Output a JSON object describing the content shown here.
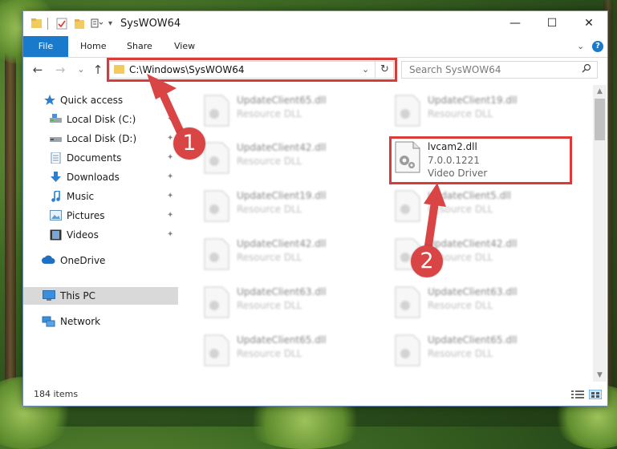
{
  "window": {
    "title": "SysWOW64",
    "controls": {
      "minimize": "—",
      "maximize": "☐",
      "close": "✕"
    }
  },
  "ribbon": {
    "tabs": [
      "File",
      "Home",
      "Share",
      "View"
    ],
    "collapse_glyph": "⌄",
    "help_glyph": "?"
  },
  "navbar": {
    "back": "←",
    "forward": "→",
    "recent": "⌄",
    "up": "↑",
    "address": "C:\\Windows\\SysWOW64",
    "address_dropdown": "⌄",
    "refresh": "↻",
    "search_placeholder": "Search SysWOW64",
    "search_icon": "search-icon"
  },
  "sidebar": {
    "items": [
      {
        "label": "Quick access",
        "icon": "star-icon",
        "pinned": false
      },
      {
        "label": "Local Disk (C:)",
        "icon": "drive-icon",
        "pinned": true
      },
      {
        "label": "Local Disk (D:)",
        "icon": "drive-icon",
        "pinned": true
      },
      {
        "label": "Documents",
        "icon": "documents-icon",
        "pinned": true
      },
      {
        "label": "Downloads",
        "icon": "download-icon",
        "pinned": true
      },
      {
        "label": "Music",
        "icon": "music-icon",
        "pinned": true
      },
      {
        "label": "Pictures",
        "icon": "pictures-icon",
        "pinned": true
      },
      {
        "label": "Videos",
        "icon": "videos-icon",
        "pinned": true
      },
      {
        "label": "OneDrive",
        "icon": "cloud-icon",
        "pinned": false
      },
      {
        "label": "This PC",
        "icon": "computer-icon",
        "pinned": false,
        "selected": true
      },
      {
        "label": "Network",
        "icon": "network-icon",
        "pinned": false
      }
    ],
    "pin_glyph": "📌"
  },
  "files": {
    "left_column": [
      {
        "name": "UpdateClient65.dll",
        "desc": "Resource DLL"
      },
      {
        "name": "UpdateClient42.dll",
        "desc": "Resource DLL"
      },
      {
        "name": "UpdateClient19.dll",
        "desc": "Resource DLL"
      },
      {
        "name": "UpdateClient42.dll",
        "desc": "Resource DLL"
      },
      {
        "name": "UpdateClient63.dll",
        "desc": "Resource DLL"
      },
      {
        "name": "UpdateClient65.dll",
        "desc": "Resource DLL"
      }
    ],
    "right_column": [
      {
        "name": "UpdateClient19.dll",
        "desc": "Resource DLL"
      },
      {
        "name": "UpdateClient5.dll",
        "desc": "Resource DLL"
      },
      {
        "name": "UpdateClient42.dll",
        "desc": "Resource DLL"
      },
      {
        "name": "UpdateClient63.dll",
        "desc": "Resource DLL"
      },
      {
        "name": "UpdateClient65.dll",
        "desc": "Resource DLL"
      }
    ],
    "highlighted": {
      "name": "lvcam2.dll",
      "version": "7.0.0.1221",
      "desc": "Video Driver"
    }
  },
  "status": {
    "item_count": "184 items"
  },
  "annotations": {
    "step1": "1",
    "step2": "2",
    "color": "#d93a3a"
  }
}
